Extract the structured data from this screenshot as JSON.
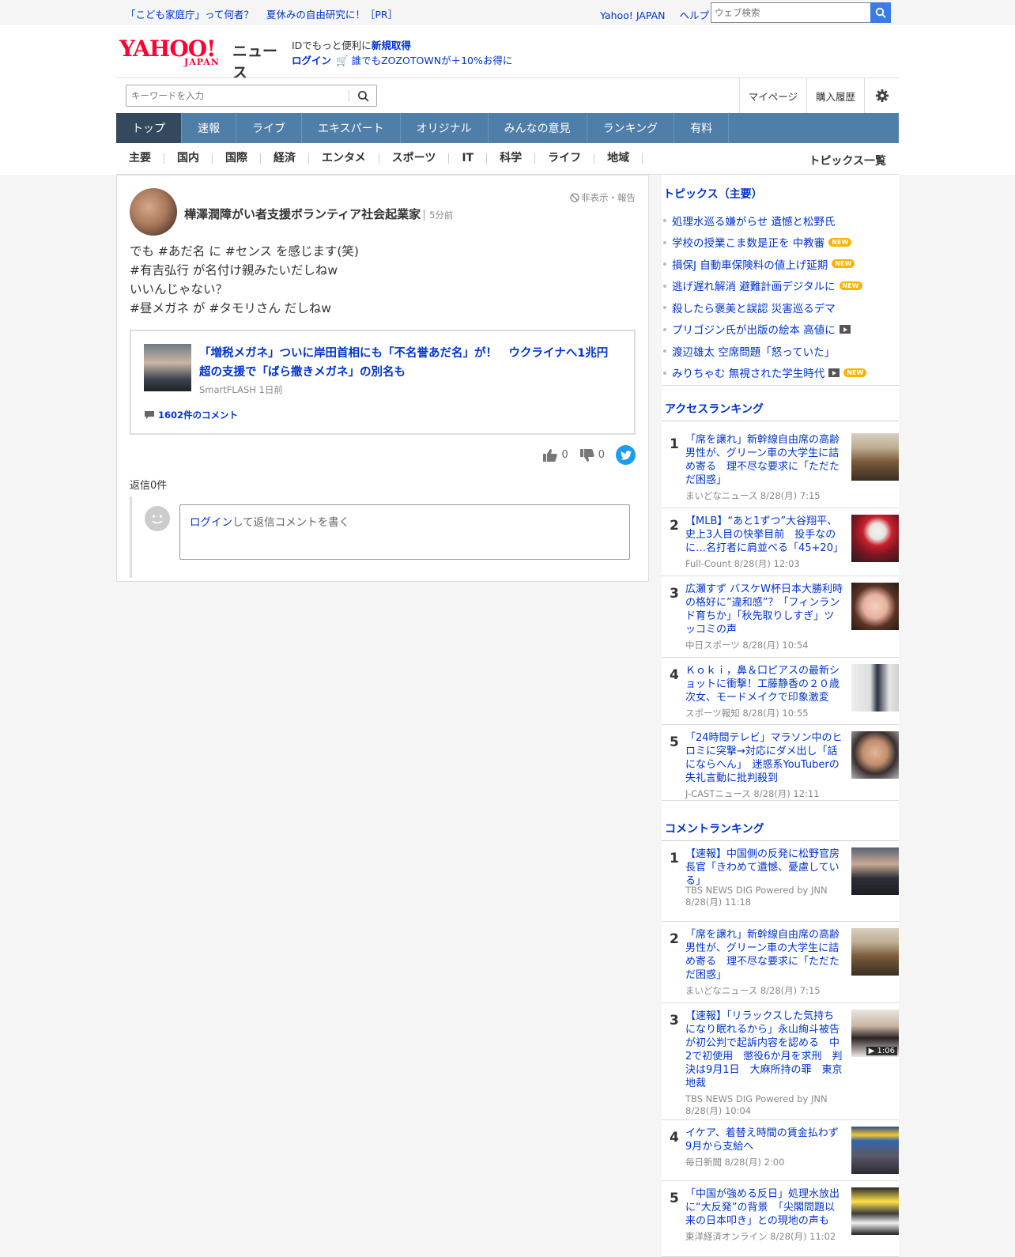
{
  "topbar": {
    "promo1": "「こども家庭庁」って何者？",
    "promo2": "夏休みの自由研究に！［PR］",
    "link1": "Yahoo! JAPAN",
    "link2": "ヘルプ",
    "search_placeholder": "ウェブ検索"
  },
  "header": {
    "logo_yahoo": "YAHOO!",
    "logo_japan": "JAPAN",
    "logo_news": "ニュース",
    "id_text": "IDでもっと便利に",
    "id_link": "新規取得",
    "login": "ログイン",
    "zozo": "誰でもZOZOTOWNが＋10%お得に"
  },
  "subhead": {
    "keyword_placeholder": "キーワードを入力",
    "mypage": "マイページ",
    "history": "購入履歴"
  },
  "mainnav": [
    "トップ",
    "速報",
    "ライブ",
    "エキスパート",
    "オリジナル",
    "みんなの意見",
    "ランキング",
    "有料"
  ],
  "catnav": {
    "items": [
      "主要",
      "国内",
      "国際",
      "経済",
      "エンタメ",
      "スポーツ",
      "IT",
      "科学",
      "ライフ",
      "地域"
    ],
    "all": "トピックス一覧"
  },
  "post": {
    "author": "樺澤潤障がい者支援ボランティア社会起業家",
    "time": "5分前",
    "hide_report": "非表示・報告",
    "lines": [
      "でも #あだ名 に #センス を感じます(笑)",
      "#有吉弘行 が名付け親みたいだしねw",
      "いいんじゃない？",
      "#昼メガネ が #タモリさん だしねw"
    ],
    "article_title": "「増税メガネ」ついに岸田首相にも「不名誉あだ名」が！　ウクライナへ1兆円超の支援で「ばら撒きメガネ」の別名も",
    "article_src": "SmartFLASH 1日前",
    "article_comments": "1602件のコメント",
    "likes": "0",
    "dislikes": "0",
    "replies": "返信0件",
    "reply_login": "ログイン",
    "reply_placeholder": "して返信コメントを書く"
  },
  "topics": {
    "title": "トピックス（主要）",
    "items": [
      {
        "text": "処理水巡る嫌がらせ 遺憾と松野氏"
      },
      {
        "text": "学校の授業こま数是正を 中教審",
        "new": "NEW"
      },
      {
        "text": "損保J 自動車保険料の値上げ延期",
        "new": "NEW"
      },
      {
        "text": "逃げ遅れ解消 避難計画デジタルに",
        "new": "NEW"
      },
      {
        "text": "殺したら褒美と誤認 災害巡るデマ"
      },
      {
        "text": "プリゴジン氏が出版の絵本 高値に",
        "video": true
      },
      {
        "text": "渡辺雄太 空席問題「怒っていた」"
      },
      {
        "text": "みりちゃむ 無視された学生時代",
        "video": true,
        "new": "NEW"
      }
    ]
  },
  "access_ranking": {
    "title": "アクセスランキング",
    "items": [
      {
        "num": "1",
        "title": "「席を譲れ」新幹線自由席の高齢男性が、グリーン車の大学生に詰め寄る　理不尽な要求に「ただただ困惑」",
        "meta": "まいどなニュース 8/28(月) 7:15",
        "img": "train"
      },
      {
        "num": "2",
        "title": "【MLB】“あと1ずつ”大谷翔平、史上3人目の快挙目前　投手なのに…名打者に肩並べる「45+20」",
        "meta": "Full-Count 8/28(月) 12:03",
        "img": "baseball"
      },
      {
        "num": "3",
        "title": "広瀬すず バスケW杯日本大勝利時の格好に”違和感”？「フィンランド育ちか」「秋先取りしすぎ」ツッコミの声",
        "meta": "中日スポーツ 8/28(月) 10:54",
        "img": "face"
      },
      {
        "num": "4",
        "title": "Ｋｏｋｉ，鼻＆口ピアスの最新ショットに衝撃！工藤静香の２０歳次女、モードメイクで印象激変",
        "meta": "スポーツ報知 8/28(月) 10:55",
        "img": "fashion"
      },
      {
        "num": "5",
        "title": "「24時間テレビ」マラソン中のヒロミに突撃→対応にダメ出し「話にならへん」　迷惑系YouTuberの失礼言動に批判殺到",
        "meta": "J-CASTニュース 8/28(月) 12:11",
        "img": "man"
      }
    ]
  },
  "comment_ranking": {
    "title": "コメントランキング",
    "items": [
      {
        "num": "1",
        "title": "【速報】中国側の反発に松野官房長官「きわめて遺憾、憂慮している」",
        "meta": "TBS NEWS DIG Powered by JNN 8/28(月) 11:18",
        "img": "official"
      },
      {
        "num": "2",
        "title": "「席を譲れ」新幹線自由席の高齢男性が、グリーン車の大学生に詰め寄る　理不尽な要求に「ただただ困惑」",
        "meta": "まいどなニュース 8/28(月) 7:15",
        "img": "train"
      },
      {
        "num": "3",
        "title": "【速報】「リラックスした気持ちになり眠れるから」永山絢斗被告が初公判で起訴内容を認める　中2で初使用　懲役6か月を求刑　判決は9月1日　大麻所持の罪　東京地裁",
        "meta": "TBS NEWS DIG Powered by JNN 8/28(月) 10:04",
        "img": "actor",
        "duration": "▶ 1:06"
      },
      {
        "num": "4",
        "title": "イケア、着替え時間の賃金払わず　9月から支給へ",
        "meta": "毎日新聞 8/28(月) 2:00",
        "img": "crowd"
      },
      {
        "num": "5",
        "title": "「中国が強める反日」処理水放出に“大反発”の背景　「尖閣問題以来の日本叩き」との現地の声も",
        "meta": "東洋経済オンライン 8/28(月) 11:02",
        "img": "protest"
      }
    ]
  },
  "colors": {
    "link": "#0033cc",
    "nav": "#4f7ea8",
    "nav_active": "#34495e",
    "new_badge": "#ffb100"
  }
}
